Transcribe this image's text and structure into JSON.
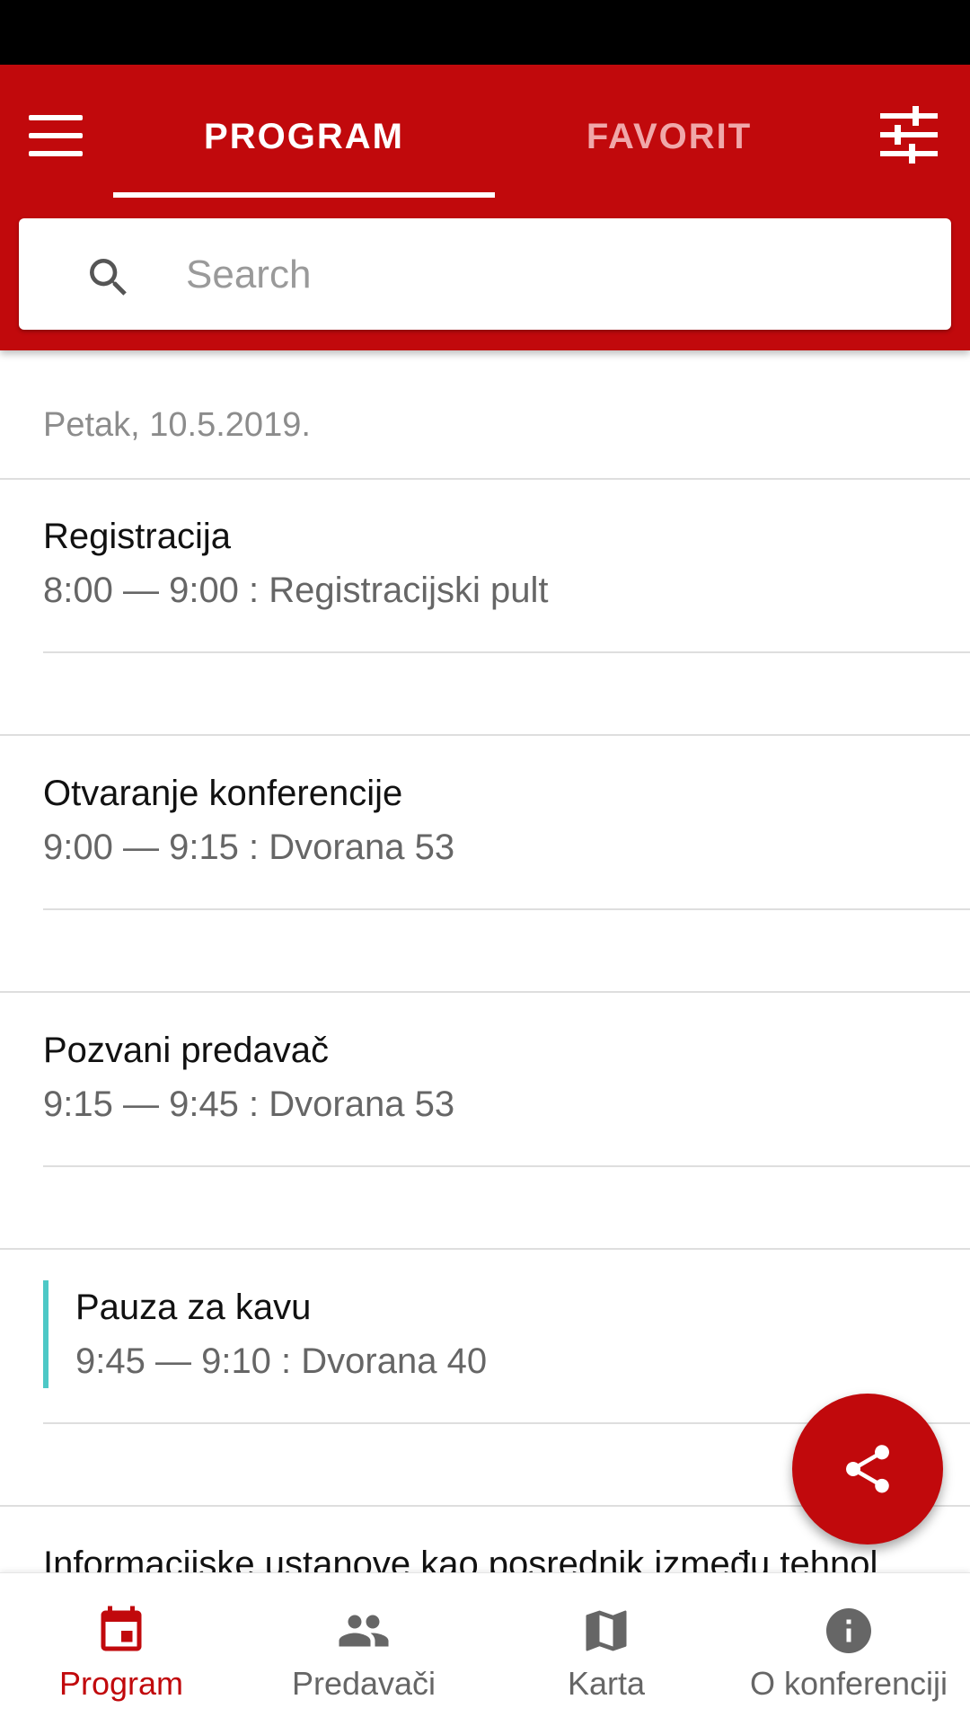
{
  "app": {
    "accent_color": "#c1090c",
    "marker_color": "#4dc8c6"
  },
  "tabs": {
    "program": "PROGRAM",
    "favorit": "FAVORIT",
    "active": "program"
  },
  "search": {
    "placeholder": "Search",
    "value": ""
  },
  "schedule": {
    "day_label": "Petak, 10.5.2019.",
    "sessions": [
      {
        "title": "Registracija",
        "time_location": "8:00 — 9:00 : Registracijski pult"
      },
      {
        "title": "Otvaranje konferencije",
        "time_location": "9:00 — 9:15 : Dvorana 53"
      },
      {
        "title": "Pozvani predavač",
        "time_location": "9:15 — 9:45 : Dvorana 53"
      },
      {
        "title": "Pauza za kavu",
        "time_location": "9:45 — 9:10 : Dvorana 40"
      },
      {
        "title": "Informacijske ustanove kao posrednik između tehnol"
      }
    ]
  },
  "fab": {
    "icon": "share-icon"
  },
  "bottom_nav": {
    "items": [
      {
        "label": "Program",
        "icon": "calendar-icon",
        "active": true
      },
      {
        "label": "Predavači",
        "icon": "people-icon",
        "active": false
      },
      {
        "label": "Karta",
        "icon": "map-icon",
        "active": false
      },
      {
        "label": "O konferenciji",
        "icon": "info-icon",
        "active": false
      }
    ]
  }
}
